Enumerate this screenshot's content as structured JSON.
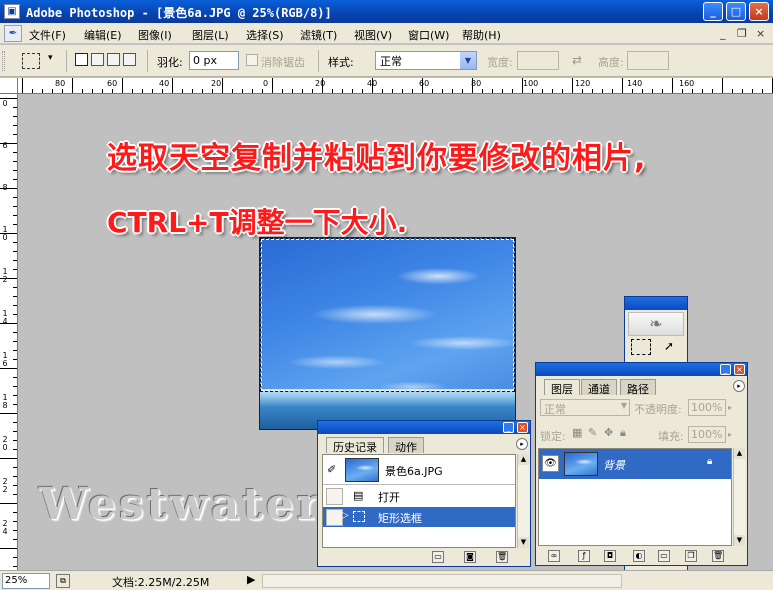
{
  "window": {
    "title": "Adobe Photoshop - [景色6a.JPG @ 25%(RGB/8)]",
    "app_icon": "photoshop-doc-icon",
    "buttons": {
      "minimize": "_",
      "maximize": "□",
      "close": "×"
    }
  },
  "menu": {
    "items": [
      {
        "label": "文件(F)"
      },
      {
        "label": "编辑(E)"
      },
      {
        "label": "图像(I)"
      },
      {
        "label": "图层(L)"
      },
      {
        "label": "选择(S)"
      },
      {
        "label": "滤镜(T)"
      },
      {
        "label": "视图(V)"
      },
      {
        "label": "窗口(W)"
      },
      {
        "label": "帮助(H)"
      }
    ],
    "doc_controls": [
      "_",
      "❐",
      "×"
    ]
  },
  "options": {
    "feather_label": "羽化:",
    "feather_value": "0 px",
    "anti_alias_label": "消除锯齿",
    "style_label": "样式:",
    "style_value": "正常",
    "width_label": "宽度:",
    "width_value": "",
    "height_label": "高度:",
    "height_value": ""
  },
  "rulers": {
    "top_labels": [
      "80",
      "60",
      "40",
      "20",
      "0",
      "20",
      "40",
      "60",
      "80",
      "100",
      "120",
      "140",
      "160"
    ],
    "left_labels": [
      "0",
      "6",
      "8",
      "1\n0",
      "1\n2",
      "1\n4",
      "1\n6",
      "1\n8",
      "2\n0",
      "2\n2",
      "2\n4"
    ]
  },
  "canvas": {
    "annotation_line1": "选取天空复制并粘贴到你要修改的相片,",
    "annotation_line2": "CTRL+T调整一下大小.",
    "watermark": "Westwater",
    "annotation_color": "#ff1a1a"
  },
  "status": {
    "zoom": "25%",
    "doc_info": "文档:2.25M/2.25M",
    "arrow": "▶"
  },
  "history_palette": {
    "tabs": [
      "历史记录",
      "动作"
    ],
    "snapshot_label": "景色6a.JPG",
    "steps": [
      {
        "label": "打开",
        "selected": false
      },
      {
        "label": "矩形选框",
        "selected": true
      }
    ]
  },
  "layers_palette": {
    "tabs": [
      "图层",
      "通道",
      "路径"
    ],
    "blend_mode": "正常",
    "opacity_label": "不透明度:",
    "opacity_value": "100%",
    "lock_label": "锁定:",
    "fill_label": "填充:",
    "fill_value": "100%",
    "layers": [
      {
        "name": "背景",
        "visible": true,
        "locked": true,
        "selected": true
      }
    ]
  },
  "colors": {
    "title_blue": "#0a48c0",
    "selection_blue": "#316ac5",
    "panel_bg": "#ece9d8",
    "canvas_gray": "#c0c0c0"
  }
}
